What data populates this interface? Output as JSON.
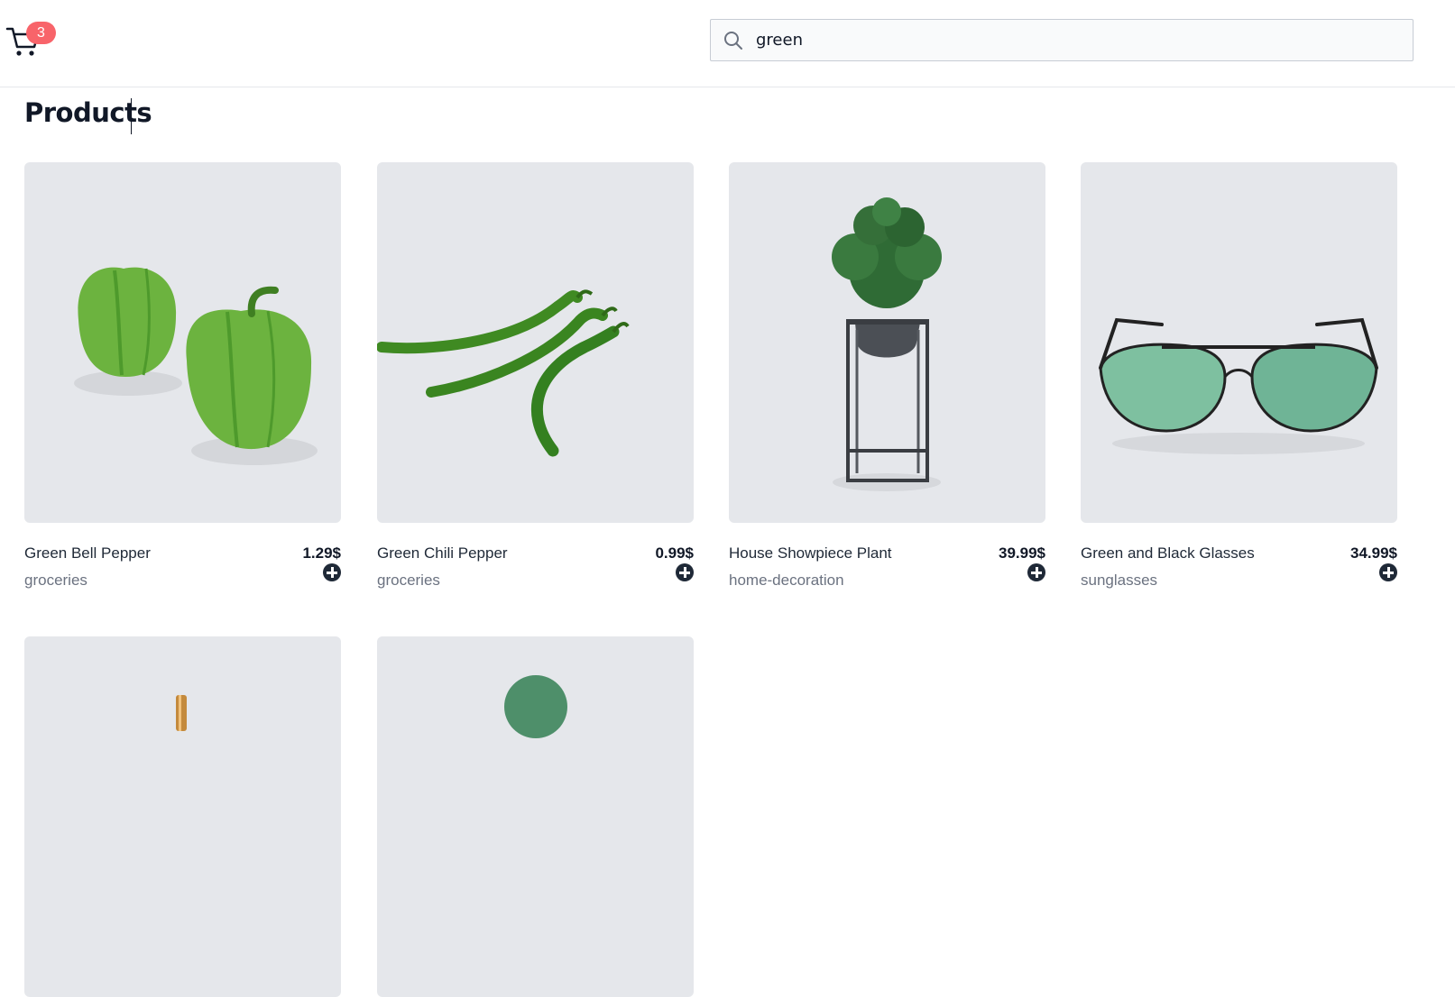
{
  "header": {
    "cart_count": "3",
    "search": {
      "value": "green",
      "placeholder": ""
    }
  },
  "page_title": "Products",
  "products": [
    {
      "name": "Green Bell Pepper",
      "category": "groceries",
      "price": "1.29$",
      "image_icon": "bell-pepper"
    },
    {
      "name": "Green Chili Pepper",
      "category": "groceries",
      "price": "0.99$",
      "image_icon": "chili-pepper"
    },
    {
      "name": "House Showpiece Plant",
      "category": "home-decoration",
      "price": "39.99$",
      "image_icon": "potted-plant"
    },
    {
      "name": "Green and Black Glasses",
      "category": "sunglasses",
      "price": "34.99$",
      "image_icon": "sunglasses"
    },
    {
      "name": "",
      "category": "",
      "price": "",
      "image_icon": "perfume-bottle"
    },
    {
      "name": "",
      "category": "",
      "price": "",
      "image_icon": "green-circle-product"
    }
  ],
  "colors": {
    "badge": "#f8646a",
    "card_bg": "#e5e7eb",
    "text_dark": "#111827",
    "text_muted": "#6b7280"
  }
}
